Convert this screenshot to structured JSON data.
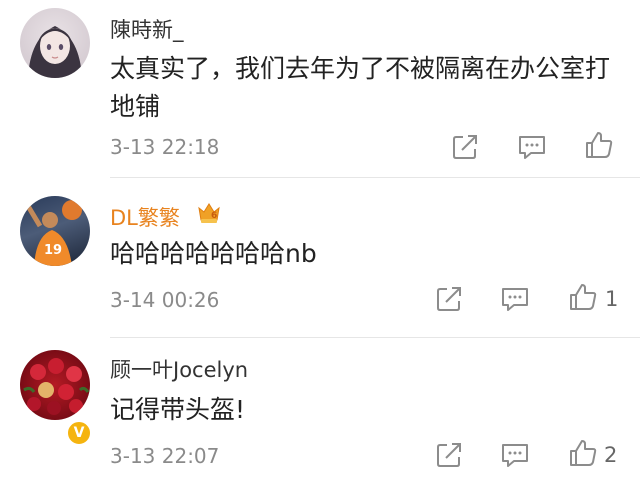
{
  "comments": [
    {
      "username": "陳時新_",
      "text": "太真实了，我们去年为了不被隔离在办公室打地铺",
      "time": "3-13 22:18",
      "likes": ""
    },
    {
      "username": "DL繁繁",
      "text": "哈哈哈哈哈哈哈nb",
      "time": "3-14 00:26",
      "likes": "1",
      "vip_badge": "6",
      "avatar_jersey": "19"
    },
    {
      "username": "顾一叶Jocelyn",
      "text": "记得带头盔!",
      "time": "3-13 22:07",
      "likes": "2"
    }
  ],
  "colors": {
    "vip_name": "#e8831f",
    "verified_badge": "#f5b40f",
    "icon_stroke": "#8c8c8c"
  },
  "icons": {
    "forward": "share-icon",
    "comment": "comment-icon",
    "like": "thumbs-up-icon"
  }
}
